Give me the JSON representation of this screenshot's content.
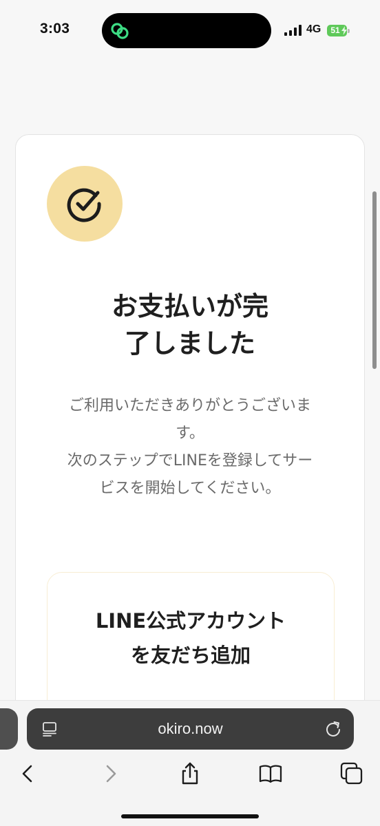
{
  "status_bar": {
    "time": "3:03",
    "network": "4G",
    "battery": "51"
  },
  "card": {
    "title": "お支払いが完\n了しました",
    "message": "ご利用いただきありがとうございま\nす。\n次のステップでLINEを登録してサー\nビスを開始してください。",
    "line_box_title": "LINE公式アカウント\nを友だち追加"
  },
  "browser": {
    "url": "okiro.now"
  },
  "icons": {
    "check": "check-circle-icon",
    "reader": "reader-icon",
    "reload": "reload-icon",
    "back": "back-chevron-icon",
    "forward": "forward-chevron-icon",
    "share": "share-icon",
    "bookmarks": "bookmarks-icon",
    "tabs": "tabs-icon"
  },
  "colors": {
    "accent_circle": "#f5dea0",
    "battery_green": "#5fc95a",
    "island_icon_green": "#3ddc84"
  }
}
